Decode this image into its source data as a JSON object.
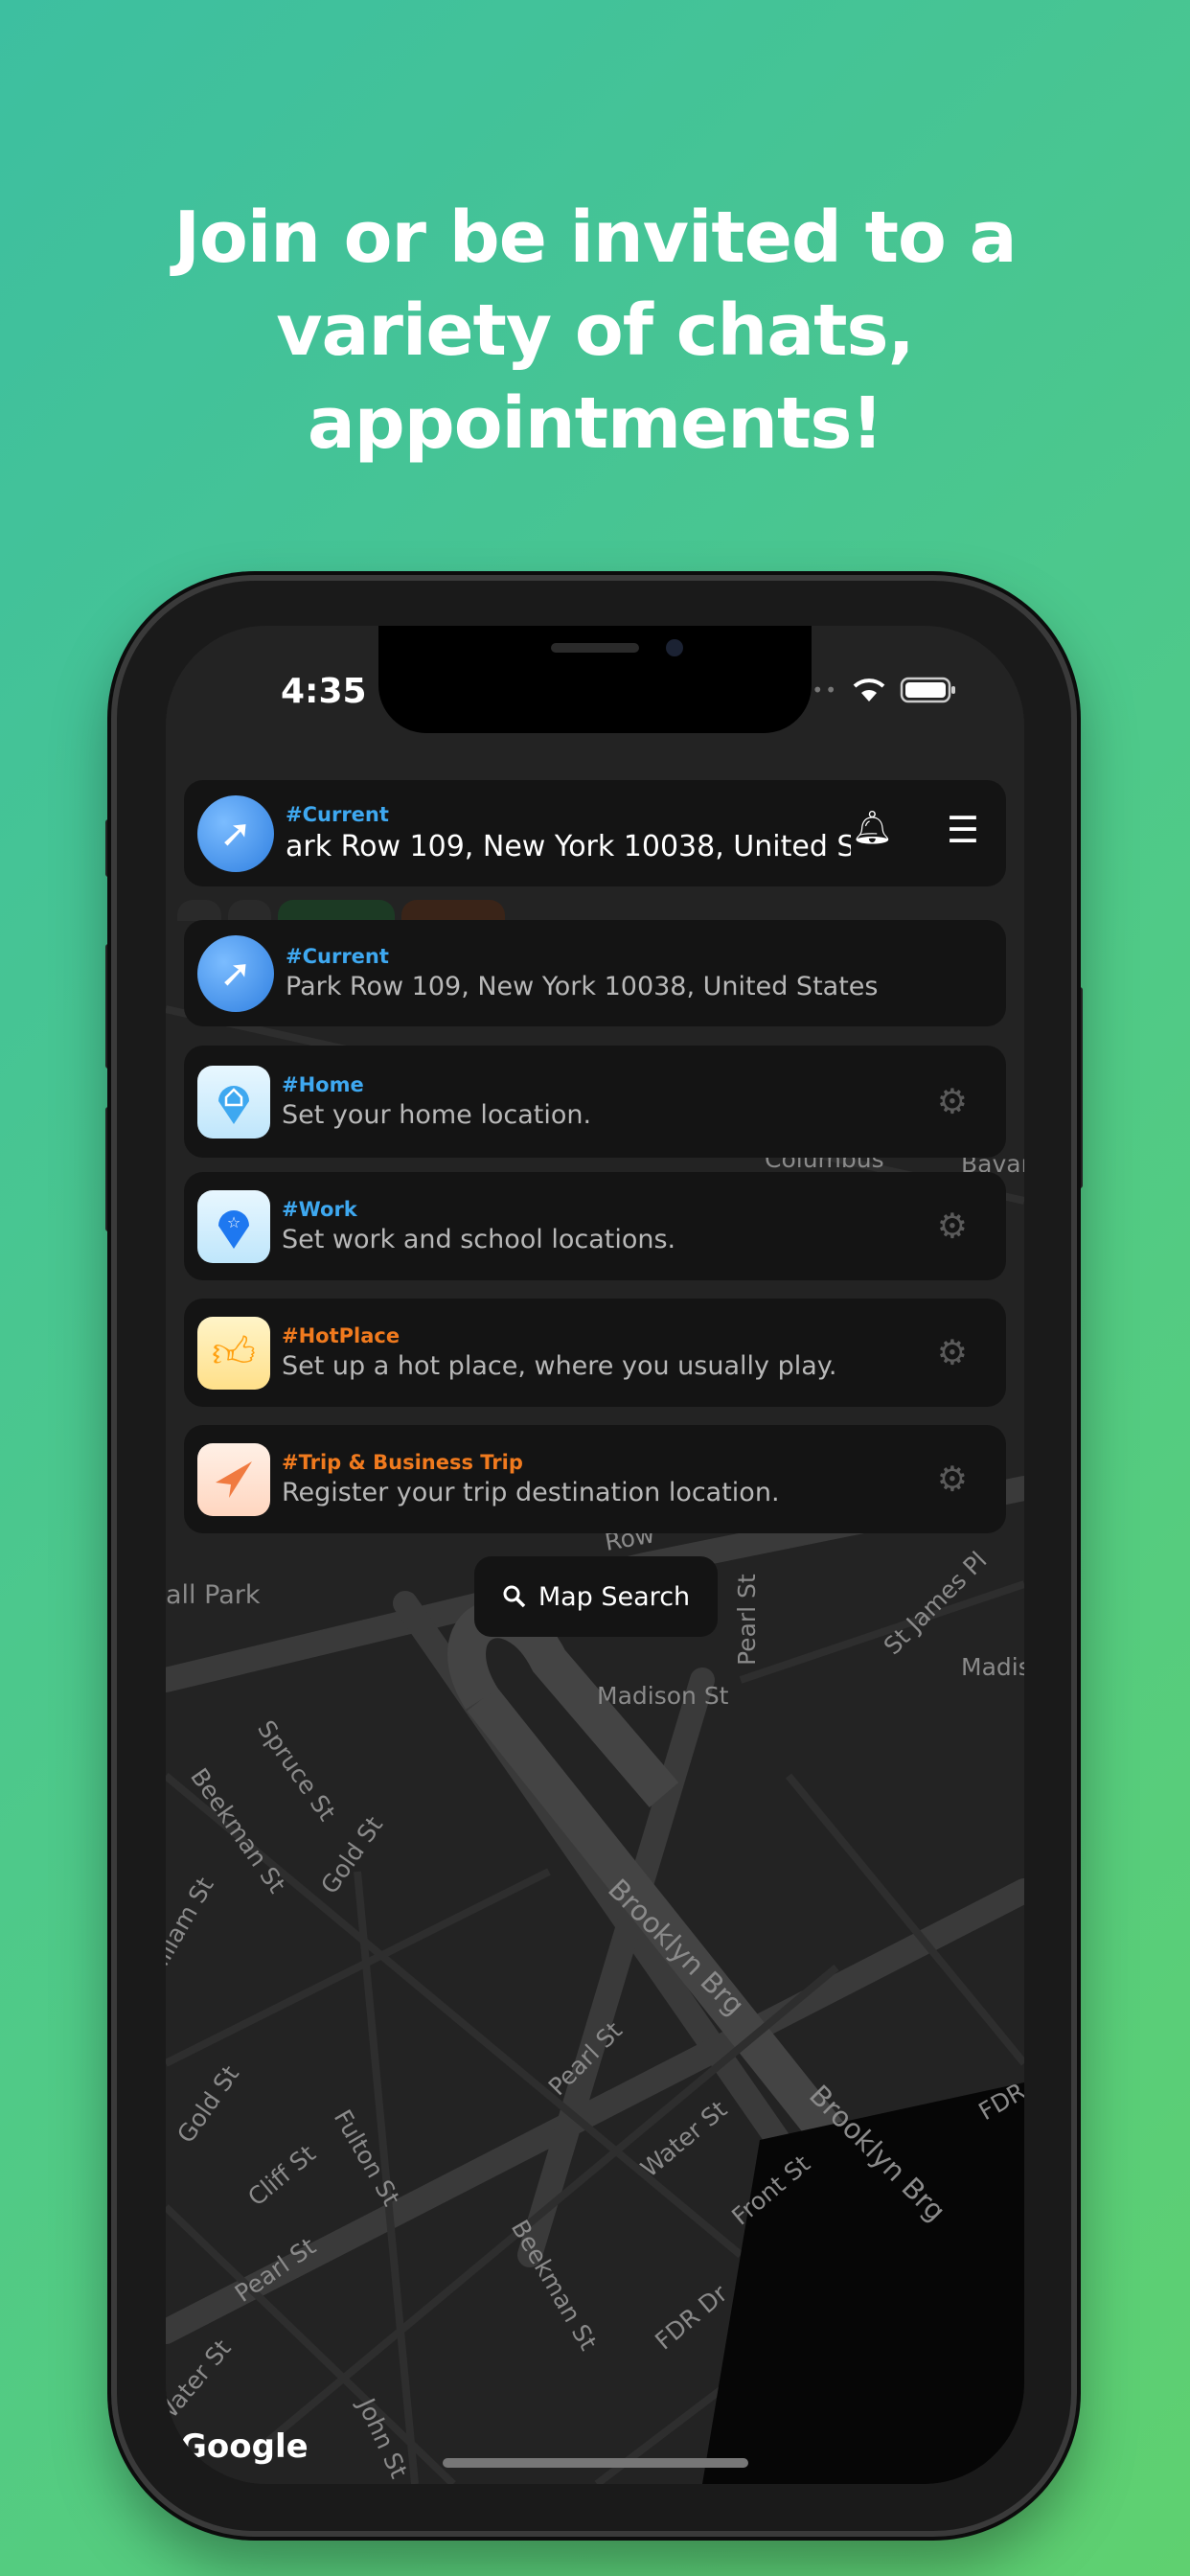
{
  "headline": {
    "line1": "Join or be invited to a",
    "line2": "variety of chats,",
    "line3": "appointments!"
  },
  "status_bar": {
    "time": "4:35"
  },
  "top_bar": {
    "tag": "#Current",
    "address": "ark Row 109, New York 10038, United S",
    "bell_icon": "bell-icon",
    "menu_icon": "hamburger-menu-icon"
  },
  "locations": [
    {
      "tag": "#Current",
      "desc": "Park Row 109, New York 10038, United States",
      "color": "#3ea8f0",
      "icon": "globe-cursor-icon"
    },
    {
      "tag": "#Home",
      "desc": "Set your home location.",
      "color": "#3ea8f0",
      "icon": "home-pin-icon"
    },
    {
      "tag": "#Work",
      "desc": "Set work and school locations.",
      "color": "#3ea8f0",
      "icon": "star-pin-icon"
    },
    {
      "tag": "#HotPlace",
      "desc": "Set up a hot place, where you usually play.",
      "color": "#f07a1e",
      "icon": "thumbs-up-icon"
    },
    {
      "tag": "#Trip & Business Trip",
      "desc": "Register your trip destination location.",
      "color": "#f07a1e",
      "icon": "paper-plane-icon"
    }
  ],
  "map_search": {
    "label": "Map Search"
  },
  "map": {
    "attribution": "Google",
    "labels": [
      "Columbus",
      "Bavar",
      "all Park",
      "Madison St",
      "Pearl St",
      "St James Pl",
      "Madis",
      "Spruce St",
      "Beekman St",
      "Gold St",
      "illiam St",
      "Brooklyn Brg",
      "Brooklyn Brg",
      "Pearl St",
      "Gold St",
      "Fulton St",
      "Cliff St",
      "Water St",
      "Front St",
      "Pearl St",
      "Beekman St",
      "FDR Dr",
      "FDR",
      "Water St",
      "John St",
      "Row"
    ]
  }
}
